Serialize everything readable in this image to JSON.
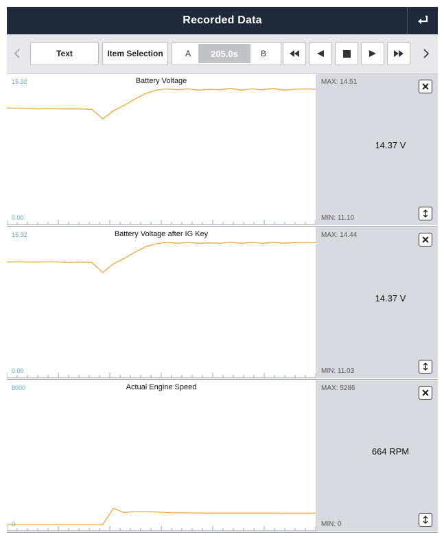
{
  "header": {
    "title": "Recorded Data"
  },
  "toolbar": {
    "text_btn": "Text",
    "item_selection_btn": "Item Selection",
    "marker_a": "A",
    "time": "205.0s",
    "marker_b": "B"
  },
  "colors": {
    "trace": "#f2a63a",
    "axis_label": "#58a9c9",
    "header_bg": "#1f2b3b",
    "side_bg": "#d7dbe1"
  },
  "panels": [
    {
      "title": "Battery Voltage",
      "y_max": "15.32",
      "y_min": "0.00",
      "max": "MAX: 14.51",
      "min": "MIN: 11.10",
      "current": "14.37 V"
    },
    {
      "title": "Battery Voltage after IG Key",
      "y_max": "15.32",
      "y_min": "0.00",
      "max": "MAX: 14.44",
      "min": "MIN: 11.03",
      "current": "14.37 V"
    },
    {
      "title": "Actual Engine Speed",
      "y_max": "8000",
      "y_min": "0",
      "max": "MAX: 5286",
      "min": "MIN: 0",
      "current": "664 RPM"
    }
  ],
  "chart_data": [
    {
      "type": "line",
      "title": "Battery Voltage",
      "ylim": [
        0,
        15.32
      ],
      "series": [
        {
          "values": [
            12.3,
            12.3,
            12.25,
            12.2,
            12.25,
            12.2,
            12.2,
            12.2,
            12.15,
            11.1,
            12.0,
            12.6,
            13.3,
            13.9,
            14.3,
            14.45,
            14.35,
            14.45,
            14.3,
            14.4,
            14.35,
            14.5,
            14.3,
            14.45,
            14.35,
            14.5,
            14.3,
            14.4,
            14.45,
            14.4
          ]
        }
      ]
    },
    {
      "type": "line",
      "title": "Battery Voltage after IG Key",
      "ylim": [
        0,
        15.32
      ],
      "series": [
        {
          "values": [
            12.2,
            12.25,
            12.2,
            12.2,
            12.25,
            12.2,
            12.15,
            12.2,
            12.15,
            11.03,
            12.0,
            12.6,
            13.3,
            13.9,
            14.25,
            14.4,
            14.3,
            14.4,
            14.3,
            14.35,
            14.3,
            14.44,
            14.3,
            14.4,
            14.3,
            14.42,
            14.3,
            14.38,
            14.4,
            14.37
          ]
        }
      ]
    },
    {
      "type": "line",
      "title": "Actual Engine Speed",
      "ylim": [
        0,
        8000
      ],
      "series": [
        {
          "values": [
            0,
            0,
            0,
            0,
            0,
            0,
            0,
            0,
            0,
            0,
            950,
            700,
            760,
            760,
            740,
            700,
            690,
            680,
            675,
            670,
            670,
            668,
            668,
            667,
            666,
            666,
            665,
            665,
            664,
            664
          ]
        }
      ]
    }
  ]
}
